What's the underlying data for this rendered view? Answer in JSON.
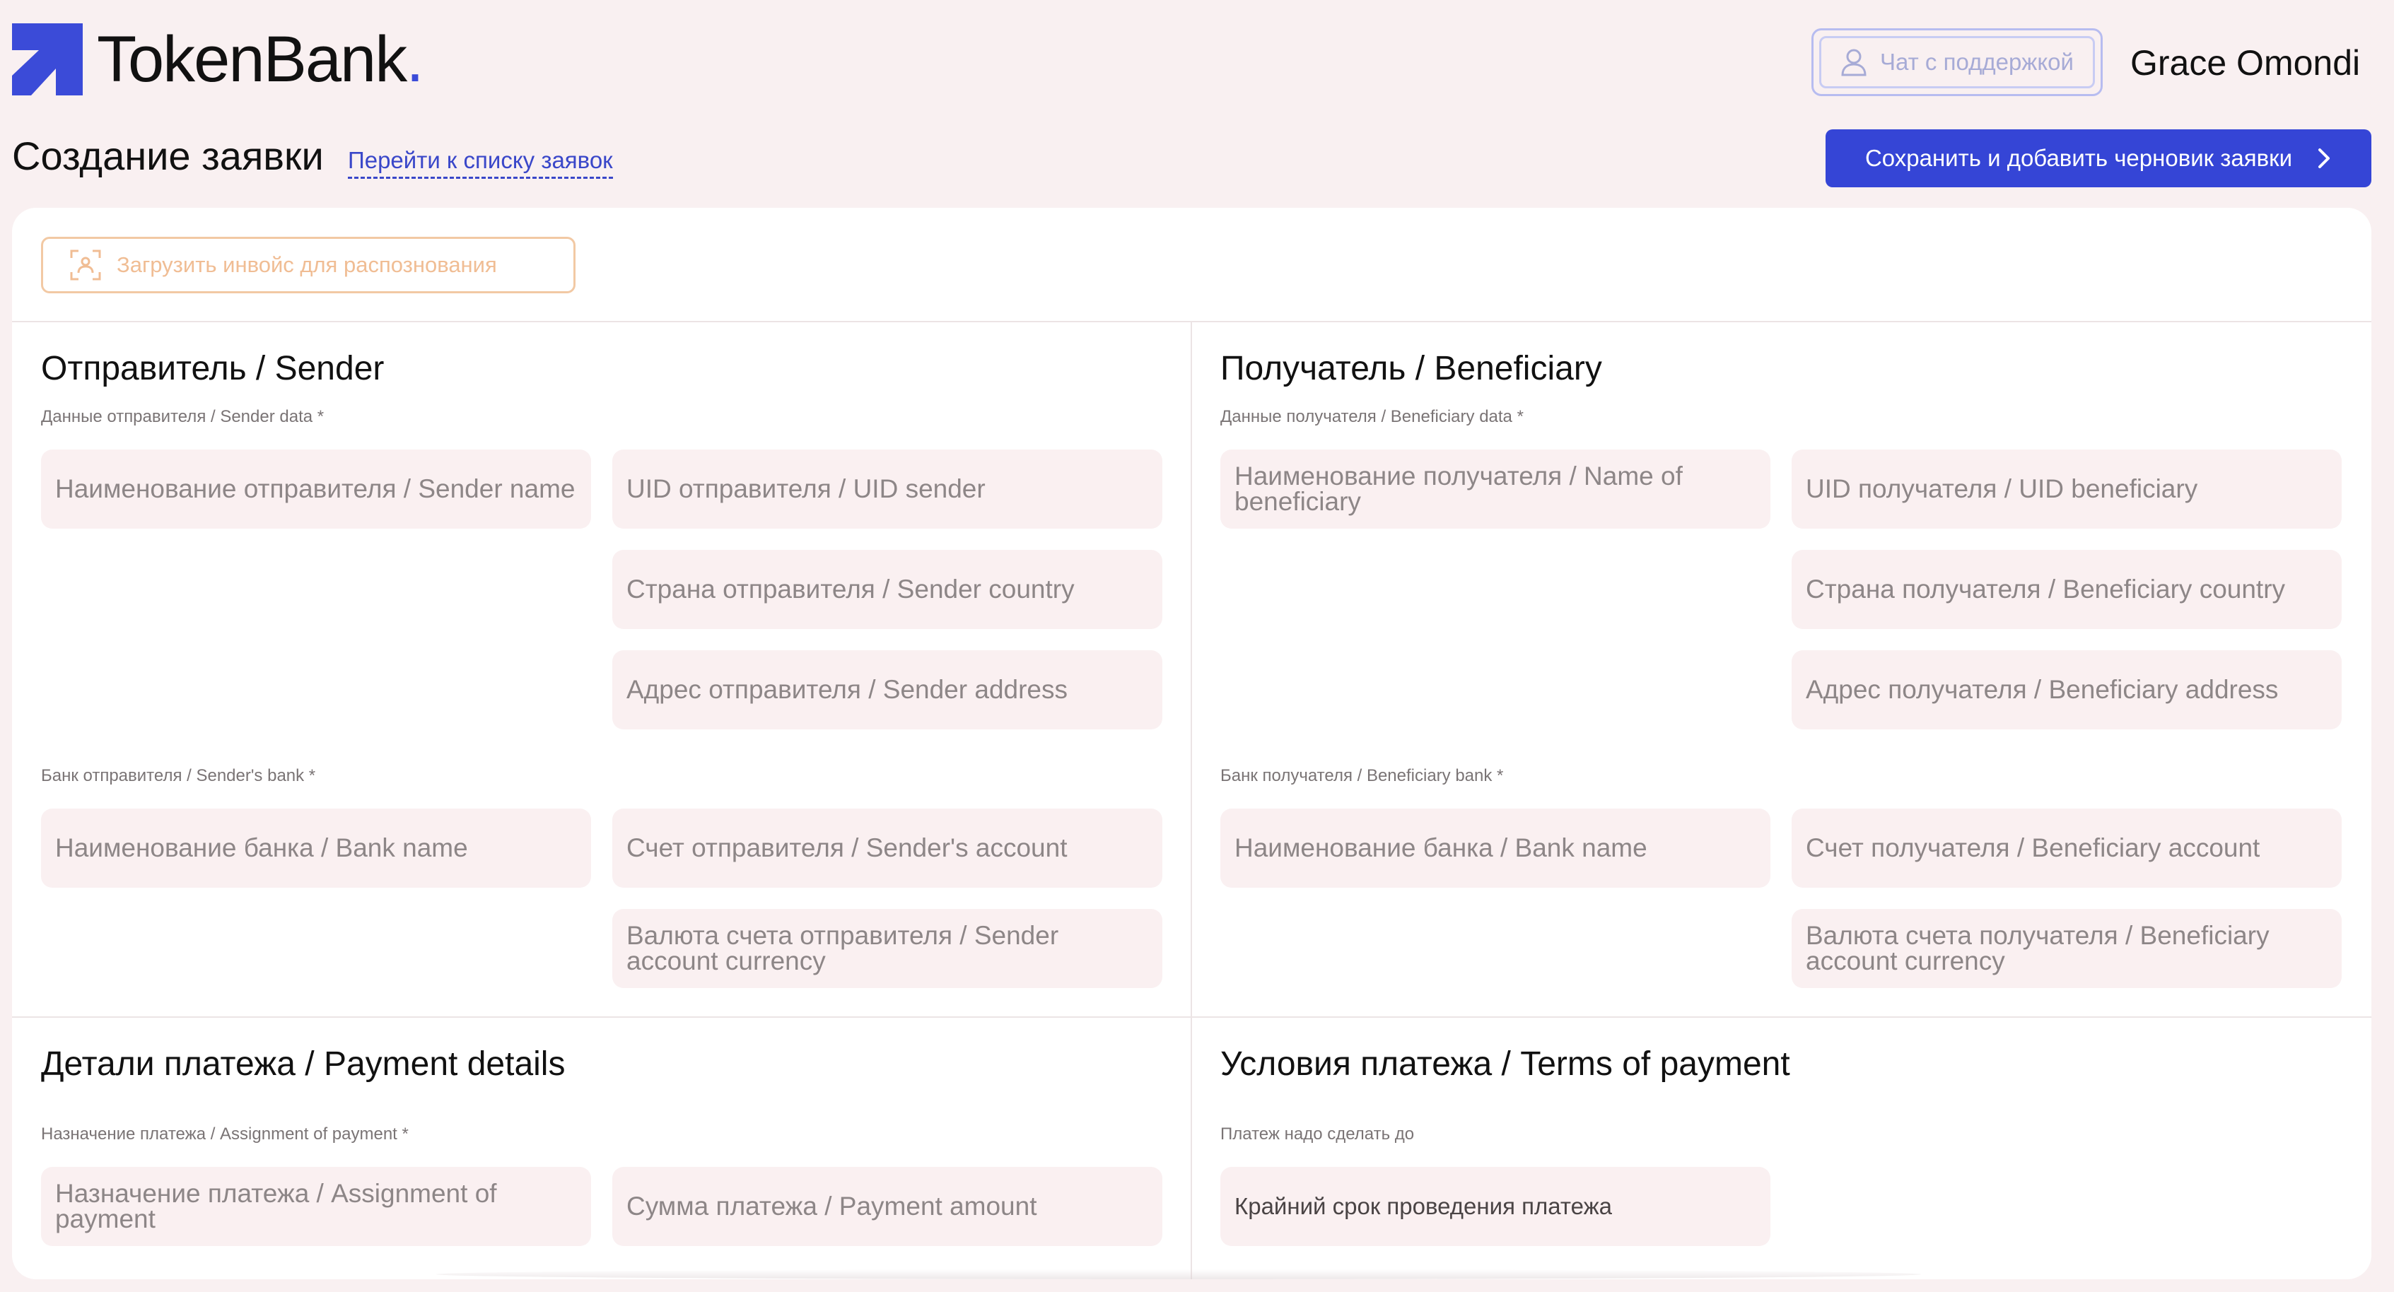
{
  "header": {
    "logo_text": "TokenBank",
    "logo_dot": ".",
    "support_label": "Чат с поддержкой",
    "user_name": "Grace Omondi"
  },
  "page": {
    "title": "Создание заявки",
    "list_link": "Перейти к списку заявок",
    "save_label": "Сохранить и добавить черновик заявки"
  },
  "upload": {
    "label": "Загрузить инвойс для распознования"
  },
  "sender": {
    "title": "Отправитель / Sender",
    "data_label": "Данные отправителя / Sender data *",
    "name_placeholder": "Наименование отправителя / Sender name",
    "uid_placeholder": "UID отправителя / UID sender",
    "country_placeholder": "Страна отправителя / Sender country",
    "address_placeholder": "Адрес отправителя / Sender address",
    "bank_label": "Банк отправителя / Sender's bank *",
    "bank_name_placeholder": "Наименование банка / Bank name",
    "account_placeholder": "Счет отправителя / Sender's account",
    "currency_placeholder": "Валюта счета отправителя / Sender account currency"
  },
  "beneficiary": {
    "title": "Получатель / Beneficiary",
    "data_label": "Данные получателя / Beneficiary data *",
    "name_placeholder": "Наименование получателя / Name of beneficiary",
    "uid_placeholder": "UID получателя / UID beneficiary",
    "country_placeholder": "Страна получателя / Beneficiary country",
    "address_placeholder": "Адрес получателя / Beneficiary address",
    "bank_label": "Банк получателя / Beneficiary bank *",
    "bank_name_placeholder": "Наименование банка / Bank name",
    "account_placeholder": "Счет получателя / Beneficiary account",
    "currency_placeholder": "Валюта счета получателя / Beneficiary account currency"
  },
  "payment_details": {
    "title": "Детали платежа / Payment details",
    "assignment_label": "Назначение платежа / Assignment of payment *",
    "assignment_placeholder": "Назначение платежа / Assignment of payment",
    "amount_placeholder": "Сумма платежа / Payment amount"
  },
  "payment_terms": {
    "title": "Условия платежа / Terms of payment",
    "deadline_label": "Платеж надо сделать до",
    "deadline_placeholder": "Крайний срок проведения платежа"
  },
  "colors": {
    "accent": "#3545d6",
    "background": "#f9f0f1",
    "field_bg": "#faf0f1",
    "upload_border": "#f2c9a4"
  },
  "icons": [
    "logo-arrow-icon",
    "user-icon",
    "chevron-right-icon",
    "scan-icon"
  ]
}
